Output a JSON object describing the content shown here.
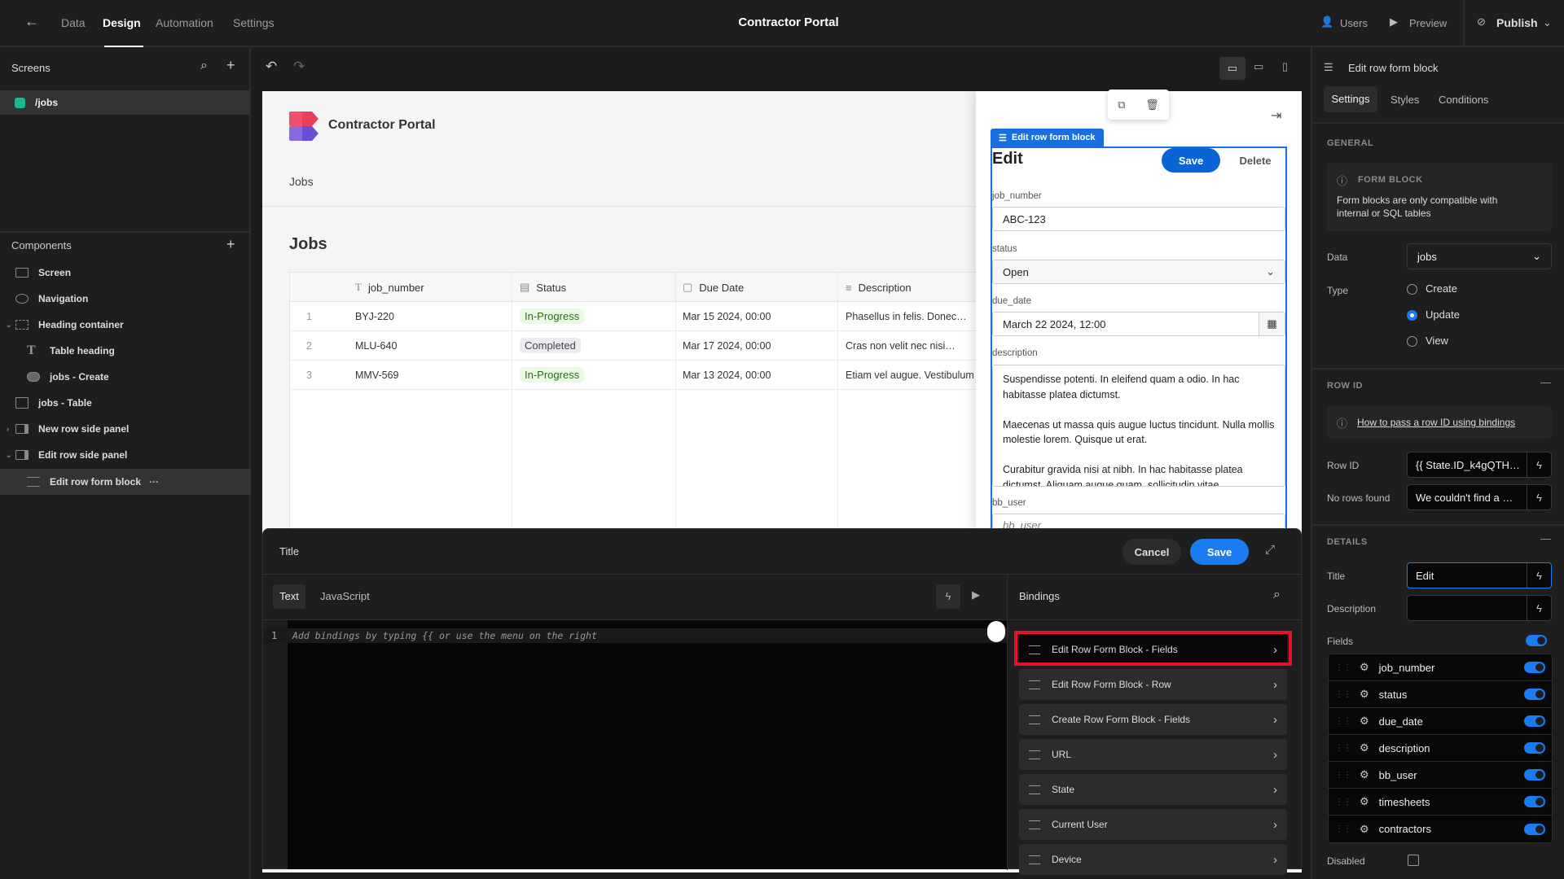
{
  "topbar": {
    "nav": [
      "Data",
      "Design",
      "Automation",
      "Settings"
    ],
    "active": "Design",
    "title": "Contractor Portal",
    "users": "Users",
    "preview": "Preview",
    "publish": "Publish"
  },
  "screens": {
    "title": "Screens",
    "items": [
      {
        "label": "/jobs",
        "color": "#1fb58f"
      }
    ]
  },
  "components": {
    "title": "Components",
    "items": [
      "Screen",
      "Navigation",
      "Heading container",
      "Table heading",
      "jobs - Create",
      "jobs - Table",
      "New row side panel",
      "Edit row side panel",
      "Edit row form block"
    ],
    "more": "···"
  },
  "preview": {
    "app_title": "Contractor Portal",
    "nav_link": "Jobs",
    "heading": "Jobs",
    "table": {
      "columns": [
        "job_number",
        "Status",
        "Due Date",
        "Description"
      ],
      "rows": [
        {
          "n": "1",
          "job_number": "BYJ-220",
          "status": "In-Progress",
          "due": "Mar 15 2024, 00:00",
          "desc": "Phasellus in felis. Donec…"
        },
        {
          "n": "2",
          "job_number": "MLU-640",
          "status": "Completed",
          "due": "Mar 17 2024, 00:00",
          "desc": "Cras non velit nec nisi…"
        },
        {
          "n": "3",
          "job_number": "MMV-569",
          "status": "In-Progress",
          "due": "Mar 13 2024, 00:00",
          "desc": "Etiam vel augue. Vestibulum"
        }
      ]
    }
  },
  "form": {
    "tag": "Edit row form block",
    "title": "Edit",
    "save": "Save",
    "delete": "Delete",
    "fields": [
      {
        "label": "job_number",
        "value": "ABC-123"
      },
      {
        "label": "status",
        "value": "Open"
      },
      {
        "label": "due_date",
        "value": "March 22 2024, 12:00"
      },
      {
        "label": "description",
        "value": "Suspendisse potenti. In eleifend quam a odio. In hac habitasse platea dictumst.\n\nMaecenas ut massa quis augue luctus tincidunt. Nulla mollis molestie lorem. Quisque ut erat.\n\nCurabitur gravida nisi at nibh. In hac habitasse platea dictumst. Aliquam augue quam, sollicitudin vitae,"
      },
      {
        "label": "bb_user",
        "value": "bb_user"
      }
    ]
  },
  "editor": {
    "title": "Title",
    "cancel": "Cancel",
    "save": "Save",
    "tabs": [
      "Text",
      "JavaScript"
    ],
    "line": "1",
    "placeholder": "Add bindings by typing {{ or use the menu on the right",
    "bindings_title": "Bindings",
    "bindings": [
      "Edit Row Form Block - Fields",
      "Edit Row Form Block - Row",
      "Create Row Form Block - Fields",
      "URL",
      "State",
      "Current User",
      "Device"
    ],
    "highlight_color": "#e8102a"
  },
  "panel": {
    "title": "Edit row form block",
    "tabs": [
      "Settings",
      "Styles",
      "Conditions"
    ],
    "general": "GENERAL",
    "info_title": "FORM BLOCK",
    "info_text": "Form blocks are only compatible with internal or SQL tables",
    "data_label": "Data",
    "data_value": "jobs",
    "type_label": "Type",
    "types": [
      "Create",
      "Update",
      "View"
    ],
    "type_selected": "Update",
    "rowid_section": "ROW ID",
    "rowid_help": "How to pass a row ID using bindings",
    "rowid_label": "Row ID",
    "rowid_value": "{{ State.ID_k4gQTH…",
    "norows_label": "No rows found",
    "norows_value": "We couldn't find a …",
    "details": "DETAILS",
    "title_label": "Title",
    "title_value": "Edit",
    "desc_label": "Description",
    "fields_label": "Fields",
    "fields_enabled": true,
    "fields": [
      "job_number",
      "status",
      "due_date",
      "description",
      "bb_user",
      "timesheets",
      "contractors"
    ],
    "disabled_label": "Disabled",
    "disabled": false,
    "accent": "#1a7cf0"
  }
}
